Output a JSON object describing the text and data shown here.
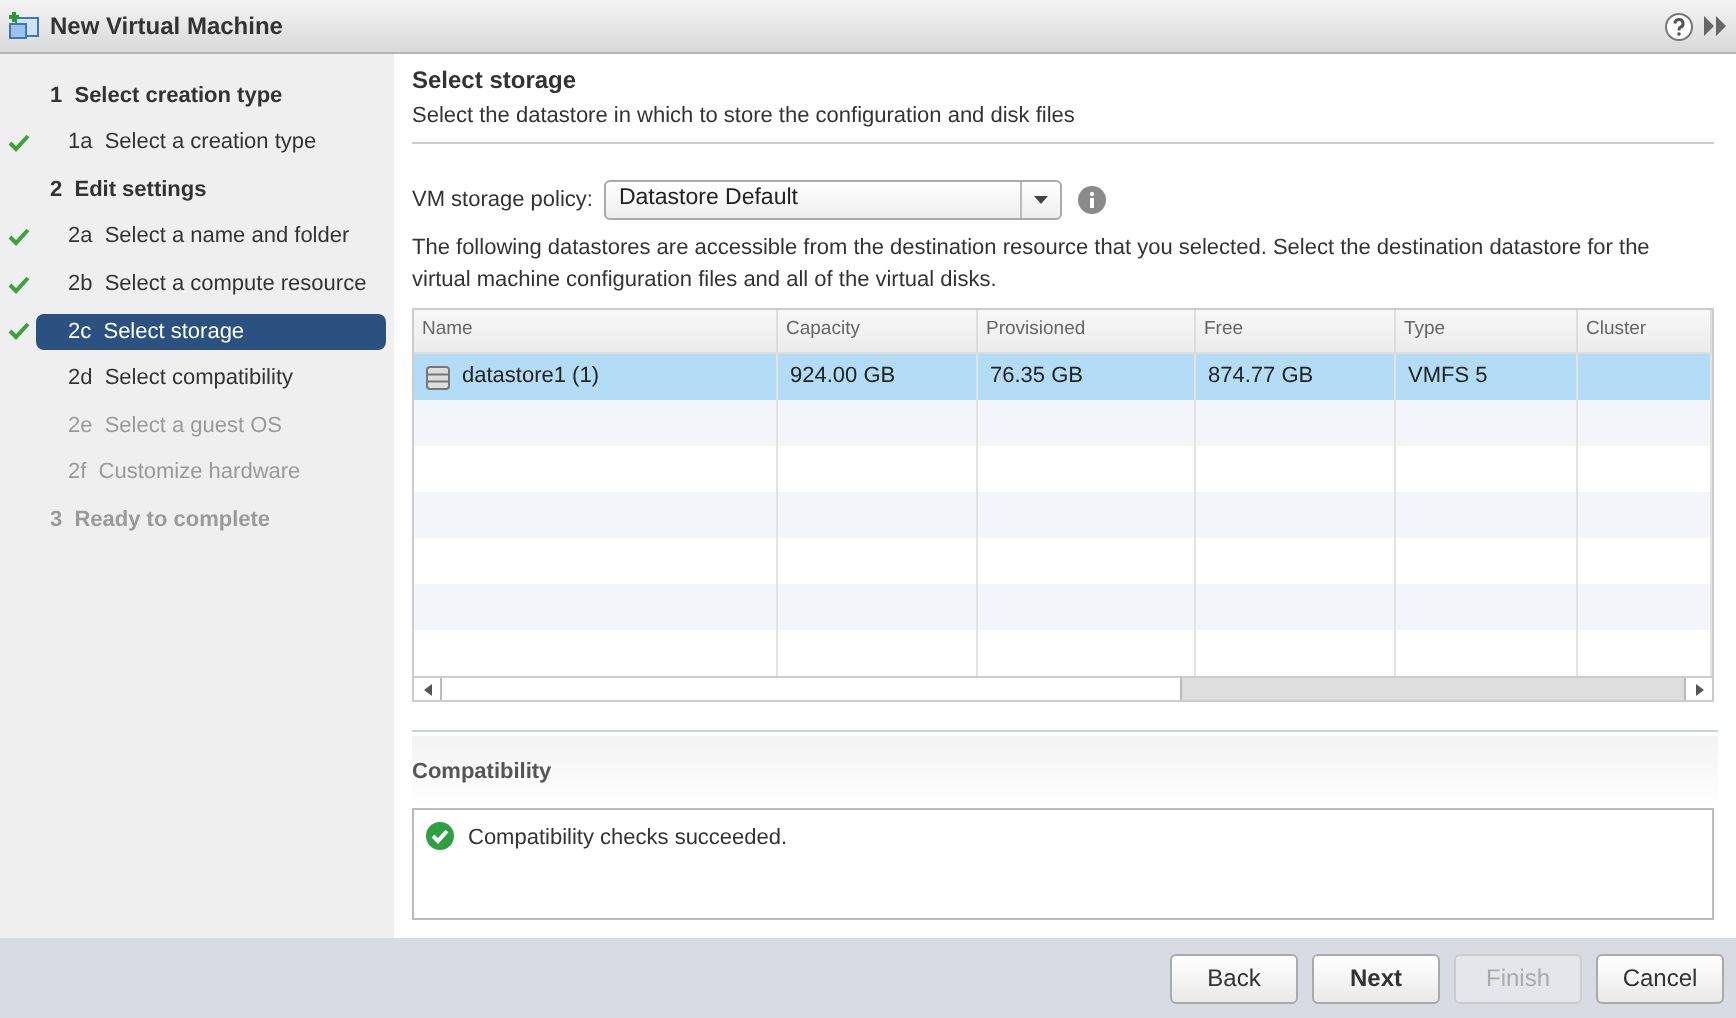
{
  "window": {
    "title": "New Virtual Machine"
  },
  "steps": [
    {
      "kind": "section",
      "number": "1",
      "label": "Select creation type",
      "completed": false,
      "selected": false,
      "disabled": false
    },
    {
      "kind": "step",
      "number": "1a",
      "label": "Select a creation type",
      "completed": true,
      "selected": false,
      "disabled": false
    },
    {
      "kind": "section",
      "number": "2",
      "label": "Edit settings",
      "completed": false,
      "selected": false,
      "disabled": false
    },
    {
      "kind": "step",
      "number": "2a",
      "label": "Select a name and folder",
      "completed": true,
      "selected": false,
      "disabled": false
    },
    {
      "kind": "step",
      "number": "2b",
      "label": "Select a compute resource",
      "completed": true,
      "selected": false,
      "disabled": false
    },
    {
      "kind": "step",
      "number": "2c",
      "label": "Select storage",
      "completed": true,
      "selected": true,
      "disabled": false
    },
    {
      "kind": "step",
      "number": "2d",
      "label": "Select compatibility",
      "completed": false,
      "selected": false,
      "disabled": false
    },
    {
      "kind": "step",
      "number": "2e",
      "label": "Select a guest OS",
      "completed": false,
      "selected": false,
      "disabled": true
    },
    {
      "kind": "step",
      "number": "2f",
      "label": "Customize hardware",
      "completed": false,
      "selected": false,
      "disabled": true
    },
    {
      "kind": "section",
      "number": "3",
      "label": "Ready to complete",
      "completed": false,
      "selected": false,
      "disabled": true
    }
  ],
  "page": {
    "title": "Select storage",
    "subtitle": "Select the datastore in which to store the configuration and disk files"
  },
  "policy": {
    "label": "VM storage policy:",
    "value": "Datastore Default"
  },
  "description": "The following datastores are accessible from the destination resource that you selected. Select the destination datastore for the virtual machine configuration files and all of the virtual disks.",
  "table": {
    "columns": [
      "Name",
      "Capacity",
      "Provisioned",
      "Free",
      "Type",
      "Cluster"
    ],
    "rows": [
      {
        "cells": [
          "datastore1 (1)",
          "924.00 GB",
          "76.35 GB",
          "874.77 GB",
          "VMFS 5",
          ""
        ],
        "selected": true
      }
    ]
  },
  "compatibility": {
    "title": "Compatibility",
    "message": "Compatibility checks succeeded."
  },
  "buttons": [
    {
      "label": "Back",
      "disabled": false,
      "primary": false
    },
    {
      "label": "Next",
      "disabled": false,
      "primary": true
    },
    {
      "label": "Finish",
      "disabled": true,
      "primary": false
    },
    {
      "label": "Cancel",
      "disabled": false,
      "primary": false
    }
  ]
}
